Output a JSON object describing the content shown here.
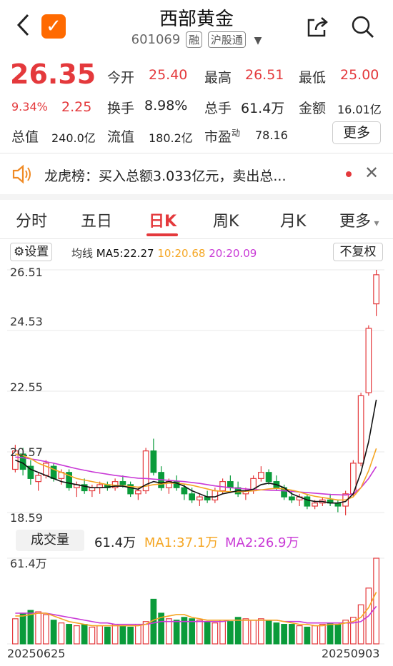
{
  "header": {
    "title": "西部黄金",
    "code": "601069",
    "tag_rong": "融",
    "tag_hgt": "沪股通"
  },
  "quote": {
    "price": "26.35",
    "change_pct": "9.34%",
    "change": "2.25",
    "open_label": "今开",
    "open": "25.40",
    "high_label": "最高",
    "high": "26.51",
    "low_label": "最低",
    "low": "25.00",
    "turnover_label": "换手",
    "turnover": "8.98%",
    "volume_label": "总手",
    "volume": "61.4万",
    "amount_label": "金额",
    "amount": "16.01亿",
    "mktcap_label": "总值",
    "mktcap": "240.0亿",
    "float_label": "流值",
    "float": "180.2亿",
    "pe_label": "市盈",
    "pe_sup": "动",
    "pe": "78.16",
    "more": "更多"
  },
  "notice": {
    "text": "龙虎榜：买入总额3.033亿元，卖出总..."
  },
  "tabs": [
    "分时",
    "五日",
    "日K",
    "周K",
    "月K",
    "更多"
  ],
  "chart_header": {
    "settings": "设置",
    "ma_label": "均线",
    "ma5": "MA5:22.27",
    "ma10": "10:20.68",
    "ma20": "20:20.09",
    "adjust": "不复权"
  },
  "price_axis": [
    "26.51",
    "24.53",
    "22.55",
    "20.57",
    "18.59"
  ],
  "volume_header": {
    "button": "成交量",
    "value": "61.4万",
    "ma1": "MA1:37.1万",
    "ma2": "MA2:26.9万",
    "axis_top": "61.4万"
  },
  "dates": {
    "start": "20250625",
    "end": "20250903"
  },
  "colors": {
    "up": "#e4393c",
    "down": "#0a9b3a",
    "ma5": "#111111",
    "ma10": "#f5a623",
    "ma20": "#c93ad6"
  },
  "chart_data": {
    "type": "candlestick",
    "ylim": [
      18.59,
      26.51
    ],
    "candles": [
      {
        "o": 20.0,
        "h": 20.8,
        "l": 19.9,
        "c": 20.6
      },
      {
        "o": 20.5,
        "h": 20.7,
        "l": 19.8,
        "c": 20.0
      },
      {
        "o": 20.1,
        "h": 20.3,
        "l": 19.5,
        "c": 19.7
      },
      {
        "o": 19.6,
        "h": 19.9,
        "l": 19.3,
        "c": 19.8
      },
      {
        "o": 19.8,
        "h": 20.3,
        "l": 19.7,
        "c": 20.2
      },
      {
        "o": 20.1,
        "h": 20.2,
        "l": 19.6,
        "c": 19.7
      },
      {
        "o": 19.7,
        "h": 20.0,
        "l": 19.5,
        "c": 19.9
      },
      {
        "o": 19.9,
        "h": 20.0,
        "l": 19.3,
        "c": 19.4
      },
      {
        "o": 19.4,
        "h": 19.6,
        "l": 19.1,
        "c": 19.5
      },
      {
        "o": 19.5,
        "h": 19.7,
        "l": 19.2,
        "c": 19.3
      },
      {
        "o": 19.3,
        "h": 19.5,
        "l": 19.1,
        "c": 19.4
      },
      {
        "o": 19.4,
        "h": 19.6,
        "l": 19.2,
        "c": 19.5
      },
      {
        "o": 19.5,
        "h": 19.6,
        "l": 19.3,
        "c": 19.4
      },
      {
        "o": 19.4,
        "h": 19.7,
        "l": 19.3,
        "c": 19.6
      },
      {
        "o": 19.6,
        "h": 19.8,
        "l": 19.4,
        "c": 19.5
      },
      {
        "o": 19.5,
        "h": 19.6,
        "l": 19.1,
        "c": 19.2
      },
      {
        "o": 19.2,
        "h": 19.4,
        "l": 19.0,
        "c": 19.3
      },
      {
        "o": 19.3,
        "h": 20.7,
        "l": 19.2,
        "c": 20.6
      },
      {
        "o": 20.6,
        "h": 21.0,
        "l": 19.8,
        "c": 19.9
      },
      {
        "o": 19.9,
        "h": 20.1,
        "l": 19.3,
        "c": 19.4
      },
      {
        "o": 19.4,
        "h": 19.7,
        "l": 19.2,
        "c": 19.6
      },
      {
        "o": 19.6,
        "h": 19.8,
        "l": 19.3,
        "c": 19.4
      },
      {
        "o": 19.4,
        "h": 19.5,
        "l": 19.0,
        "c": 19.2
      },
      {
        "o": 19.2,
        "h": 19.4,
        "l": 18.9,
        "c": 19.0
      },
      {
        "o": 19.0,
        "h": 19.2,
        "l": 18.8,
        "c": 19.1
      },
      {
        "o": 19.1,
        "h": 19.3,
        "l": 18.9,
        "c": 19.0
      },
      {
        "o": 19.0,
        "h": 19.4,
        "l": 18.9,
        "c": 19.3
      },
      {
        "o": 19.3,
        "h": 19.7,
        "l": 19.2,
        "c": 19.6
      },
      {
        "o": 19.6,
        "h": 19.8,
        "l": 19.3,
        "c": 19.4
      },
      {
        "o": 19.4,
        "h": 19.6,
        "l": 19.1,
        "c": 19.2
      },
      {
        "o": 19.2,
        "h": 19.4,
        "l": 19.0,
        "c": 19.3
      },
      {
        "o": 19.3,
        "h": 19.8,
        "l": 19.2,
        "c": 19.7
      },
      {
        "o": 19.7,
        "h": 20.1,
        "l": 19.6,
        "c": 19.9
      },
      {
        "o": 19.9,
        "h": 20.0,
        "l": 19.5,
        "c": 19.6
      },
      {
        "o": 19.6,
        "h": 19.8,
        "l": 19.3,
        "c": 19.4
      },
      {
        "o": 19.4,
        "h": 19.5,
        "l": 19.0,
        "c": 19.1
      },
      {
        "o": 19.1,
        "h": 19.3,
        "l": 18.9,
        "c": 19.0
      },
      {
        "o": 19.0,
        "h": 19.2,
        "l": 18.8,
        "c": 19.1
      },
      {
        "o": 19.1,
        "h": 19.2,
        "l": 18.7,
        "c": 18.8
      },
      {
        "o": 18.8,
        "h": 19.0,
        "l": 18.7,
        "c": 18.9
      },
      {
        "o": 18.9,
        "h": 19.1,
        "l": 18.8,
        "c": 19.0
      },
      {
        "o": 19.0,
        "h": 19.2,
        "l": 18.8,
        "c": 18.9
      },
      {
        "o": 18.9,
        "h": 19.0,
        "l": 18.6,
        "c": 18.8
      },
      {
        "o": 18.8,
        "h": 19.3,
        "l": 18.5,
        "c": 19.2
      },
      {
        "o": 19.2,
        "h": 20.3,
        "l": 19.1,
        "c": 20.2
      },
      {
        "o": 20.2,
        "h": 22.5,
        "l": 20.1,
        "c": 22.4
      },
      {
        "o": 22.5,
        "h": 24.7,
        "l": 22.4,
        "c": 24.6
      },
      {
        "o": 25.4,
        "h": 26.51,
        "l": 25.0,
        "c": 26.35
      }
    ],
    "ma5": [
      20.3,
      20.2,
      20.0,
      19.9,
      19.8,
      19.7,
      19.6,
      19.55,
      19.5,
      19.45,
      19.4,
      19.4,
      19.42,
      19.45,
      19.45,
      19.4,
      19.35,
      19.5,
      19.6,
      19.55,
      19.6,
      19.55,
      19.45,
      19.3,
      19.2,
      19.1,
      19.1,
      19.2,
      19.25,
      19.3,
      19.3,
      19.35,
      19.5,
      19.55,
      19.5,
      19.4,
      19.2,
      19.1,
      19.0,
      18.95,
      18.95,
      18.9,
      18.9,
      18.95,
      19.2,
      19.9,
      20.9,
      22.27
    ],
    "ma10": [
      20.5,
      20.45,
      20.35,
      20.2,
      20.1,
      20.0,
      19.9,
      19.8,
      19.7,
      19.65,
      19.6,
      19.55,
      19.5,
      19.48,
      19.46,
      19.44,
      19.42,
      19.45,
      19.5,
      19.52,
      19.55,
      19.55,
      19.52,
      19.48,
      19.42,
      19.36,
      19.3,
      19.28,
      19.27,
      19.27,
      19.28,
      19.3,
      19.33,
      19.36,
      19.38,
      19.36,
      19.32,
      19.26,
      19.18,
      19.12,
      19.08,
      19.04,
      19.0,
      19.0,
      19.1,
      19.4,
      19.95,
      20.68
    ],
    "ma20": [
      20.4,
      20.38,
      20.34,
      20.3,
      20.25,
      20.2,
      20.14,
      20.08,
      20.02,
      19.97,
      19.92,
      19.88,
      19.84,
      19.8,
      19.77,
      19.74,
      19.71,
      19.7,
      19.68,
      19.66,
      19.64,
      19.62,
      19.6,
      19.57,
      19.54,
      19.5,
      19.46,
      19.43,
      19.4,
      19.38,
      19.36,
      19.34,
      19.33,
      19.32,
      19.31,
      19.3,
      19.28,
      19.26,
      19.24,
      19.22,
      19.2,
      19.18,
      19.17,
      19.16,
      19.2,
      19.4,
      19.7,
      20.09
    ],
    "volume": [
      18,
      22,
      24,
      23,
      21,
      17,
      15,
      14,
      13,
      14,
      12,
      13,
      12,
      14,
      13,
      12,
      14,
      16,
      32,
      22,
      18,
      17,
      19,
      18,
      17,
      16,
      15,
      17,
      16,
      19,
      18,
      17,
      18,
      17,
      15,
      14,
      14,
      13,
      12,
      13,
      14,
      15,
      14,
      17,
      19,
      28,
      40,
      61.4
    ],
    "vol_ma1": [
      20,
      20,
      21,
      22,
      22,
      20,
      18,
      16,
      15,
      14,
      13,
      13,
      13,
      13,
      13,
      13,
      13,
      14,
      17,
      19,
      20,
      21,
      21,
      19,
      18,
      17,
      17,
      17,
      17,
      17,
      17,
      17,
      17,
      17,
      17,
      16,
      15,
      14,
      14,
      13,
      13,
      14,
      14,
      15,
      16,
      19,
      26,
      37.1
    ],
    "vol_ma2": [
      22,
      22,
      22,
      22,
      22,
      21,
      20,
      19,
      18,
      17,
      16,
      15,
      15,
      14,
      14,
      14,
      14,
      14,
      15,
      16,
      16,
      16,
      16,
      16,
      16,
      16,
      16,
      16,
      17,
      17,
      17,
      17,
      17,
      17,
      17,
      16,
      16,
      16,
      15,
      15,
      15,
      15,
      15,
      15,
      15,
      16,
      20,
      26.9
    ]
  }
}
